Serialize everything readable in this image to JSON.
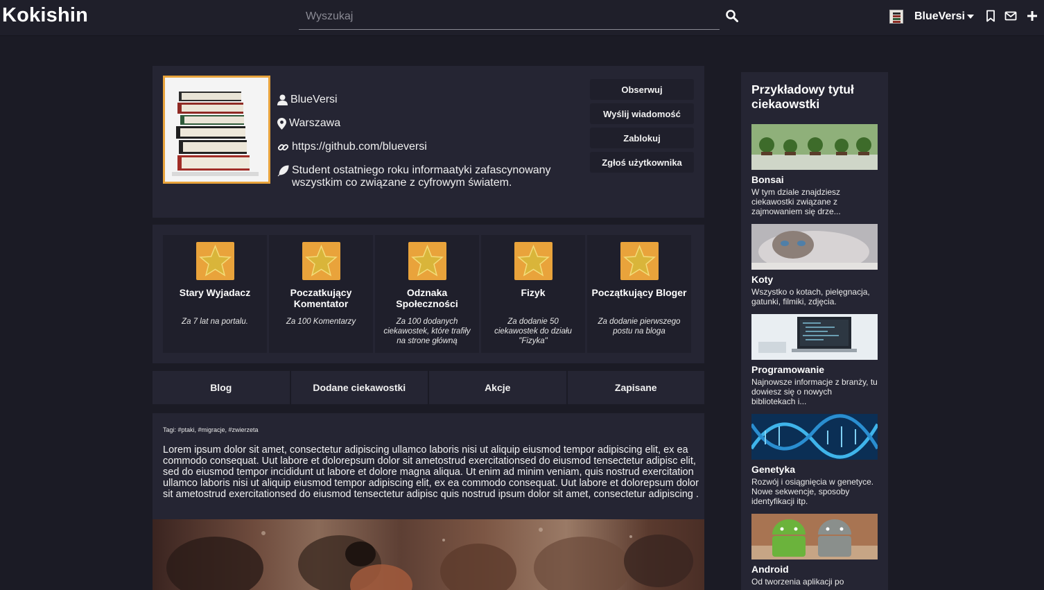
{
  "navbar": {
    "brand": "Kokishin",
    "search_placeholder": "Wyszukaj",
    "username": "BlueVersi"
  },
  "profile": {
    "username": "BlueVersi",
    "location": "Warszawa",
    "link": "https://github.com/blueversi",
    "description": "Student ostatniego roku informaatyki zafascynowany wszystkim co związane z cyfrowym światem.",
    "actions": [
      "Obserwuj",
      "Wyślij wiadomość",
      "Zablokuj",
      "Zgłoś użytkownika"
    ]
  },
  "badges": [
    {
      "name": "Stary Wyjadacz",
      "desc": "Za 7 lat na portalu."
    },
    {
      "name": "Poczatkujący Komentator",
      "desc": "Za 100 Komentarzy"
    },
    {
      "name": "Odznaka Społeczności",
      "desc": "Za 100 dodanych ciekawostek, które trafiły na strone główną"
    },
    {
      "name": "Fizyk",
      "desc": "Za dodanie 50 ciekawostek do działu \"Fizyka\""
    },
    {
      "name": "Początkujący Bloger",
      "desc": "Za dodanie pierwszego postu na bloga"
    }
  ],
  "tabs": [
    "Blog",
    "Dodane ciekawostki",
    "Akcje",
    "Zapisane"
  ],
  "post": {
    "tags": "Tagi: #ptaki, #migracje, #zwierzeta",
    "text": "Lorem ipsum dolor sit amet, consectetur adipiscing ullamco laboris nisi ut aliquip eiusmod tempor adipiscing elit, ex ea commodo consequat. Uut labore et dolorepsum dolor sit ametostrud exercitationsed do eiusmod tensectetur adipisc elit, sed do eiusmod tempor incididunt ut labore et dolore magna aliqua. Ut enim ad minim veniam, quis nostrud exercitation ullamco laboris nisi ut aliquip eiusmod tempor adipiscing elit, ex ea commodo consequat. Uut labore et dolorepsum dolor sit ametostrud exercitationsed do eiusmod tensectetur adipisc quis nostrud ipsum dolor sit amet, consectetur adipiscing ."
  },
  "sidebar": {
    "title": "Przykładowy tytuł ciekaowstki",
    "items": [
      {
        "title": "Bonsai",
        "desc": "W tym dziale znajdziesz ciekawostki związane z zajmowaniem się drze..."
      },
      {
        "title": "Koty",
        "desc": "Wszystko o kotach, pielęgnacja, gatunki, filmiki, zdjęcia."
      },
      {
        "title": "Programowanie",
        "desc": "Najnowsze informacje z branży, tu dowiesz się o nowych bibliotekach i..."
      },
      {
        "title": "Genetyka",
        "desc": "Rozwój i osiągnięcia w genetyce. Nowe sekwencje, sposoby identyfikacji itp."
      },
      {
        "title": "Android",
        "desc": "Od tworzenia aplikacji po"
      }
    ]
  },
  "colors": {
    "background": "#1b1b25",
    "panel": "#252533",
    "accent": "#e9a33b"
  },
  "icons": [
    "search-icon",
    "caret-down-icon",
    "bookmark-icon",
    "mail-icon",
    "plus-icon",
    "user-icon",
    "map-marker-icon",
    "link-icon",
    "feather-icon",
    "star-icon"
  ]
}
